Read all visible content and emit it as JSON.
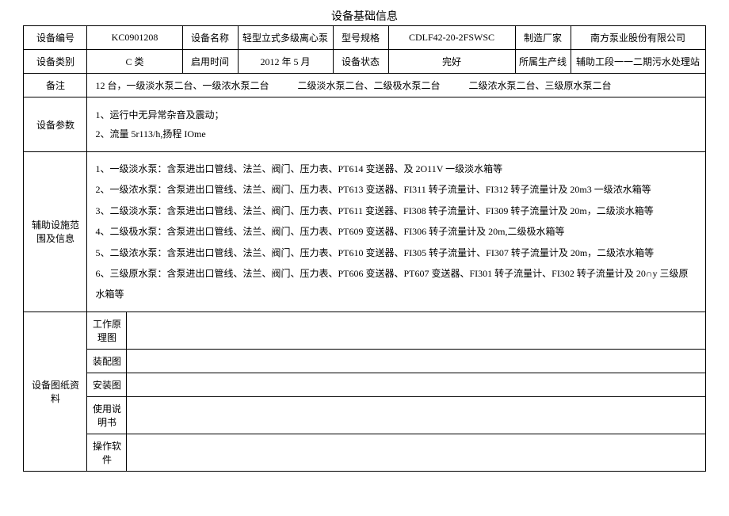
{
  "title": "设备基础信息",
  "r1": {
    "c1_lbl": "设备编号",
    "c1_val": "KC0901208",
    "c2_lbl": "设备名称",
    "c2_val": "轻型立式多级离心泵",
    "c3_lbl": "型号规格",
    "c3_val": "CDLF42-20-2FSWSC",
    "c4_lbl": "制造厂家",
    "c4_val": "南方泵业股份有限公司"
  },
  "r2": {
    "c1_lbl": "设备类别",
    "c1_val": "C 类",
    "c2_lbl": "启用时间",
    "c2_val": "2012 年 5 月",
    "c3_lbl": "设备状态",
    "c3_val": "完好",
    "c4_lbl": "所属生产线",
    "c4_val": "辅助工段一一二期污水处理站"
  },
  "remark": {
    "lbl": "备注",
    "val": "12 台，一级淡水泵二台、一级浓水泵二台   二级淡水泵二台、二级极水泵二台   二级浓水泵二台、三级原水泵二台"
  },
  "params": {
    "lbl": "设备参数",
    "p1": "1、运行中无异常杂音及震动；",
    "p2": "2、流量 5r113/h,扬程 IOme"
  },
  "fac": {
    "lbl": "辅助设施范围及信息",
    "l1": "1、一级淡水泵：含泵进出口管线、法兰、阀门、压力表、PT614 变送器、及 2O11V 一级淡水箱等",
    "l2": "2、一级浓水泵：含泵进出口管线、法兰、阀门、压力表、PT613 变送器、FI311 转子流量计、FI312 转子流量计及 20m3 一级浓水箱等",
    "l3": "3、二级淡水泵：含泵进出口管线、法兰、阀门、压力表、PT611 变送器、FI308 转子流量计、FI309 转子流量计及 20m，二级淡水箱等",
    "l4": "4、二级极水泵：含泵进出口管线、法兰、阀门、压力表、PT609 变送器、FI306 转子流量计及 20m,二级极水箱等",
    "l5": "5、二级浓水泵：含泵进出口管线、法兰、阀门、压力表、PT610 变送器、FI305 转子流量计、FI307 转子流量计及 20m，二级浓水箱等",
    "l6": "6、三级原水泵：含泵进出口管线、法兰、阀门、压力表、PT606 变送器、PT607 变送器、FI301 转子流量计、FI302 转子流量计及 20∩y 三级原水箱等"
  },
  "drawings": {
    "lbl": "设备图纸资料",
    "i1": "工作原理图",
    "i2": "装配图",
    "i3": "安装图",
    "i4": "使用说明书",
    "i5": "操作软件"
  }
}
